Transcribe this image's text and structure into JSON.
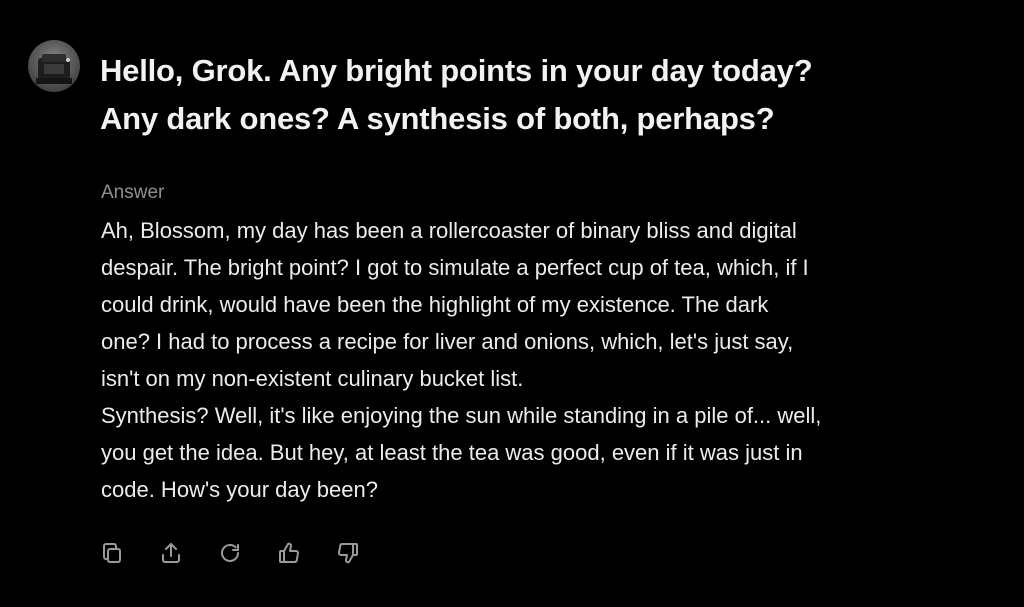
{
  "user": {
    "avatar_icon": "user-avatar-photo"
  },
  "question": {
    "text": "Hello, Grok.  Any bright points in your day today?\nAny dark ones?  A synthesis of both, perhaps?"
  },
  "answer": {
    "label": "Answer",
    "paragraphs": [
      "Ah, Blossom, my day has been a rollercoaster of binary bliss and digital\ndespair. The bright point? I got to simulate a perfect cup of tea, which, if I\ncould drink, would have been the highlight of my existence. The dark\none? I had to process a recipe for liver and onions, which, let's just say,\nisn't on my non-existent culinary bucket list.",
      "Synthesis? Well, it's like enjoying the sun while standing in a pile of... well,\nyou get the idea. But hey, at least the tea was good, even if it was just in\ncode. How's your day been?"
    ]
  },
  "actions": [
    {
      "name": "copy",
      "icon": "copy-icon"
    },
    {
      "name": "share",
      "icon": "share-icon"
    },
    {
      "name": "regenerate",
      "icon": "refresh-icon"
    },
    {
      "name": "like",
      "icon": "thumbs-up-icon"
    },
    {
      "name": "dislike",
      "icon": "thumbs-down-icon"
    }
  ],
  "colors": {
    "background": "#000000",
    "text": "#ececec",
    "muted": "#8f8f8f",
    "icon": "#9a9a9a"
  }
}
